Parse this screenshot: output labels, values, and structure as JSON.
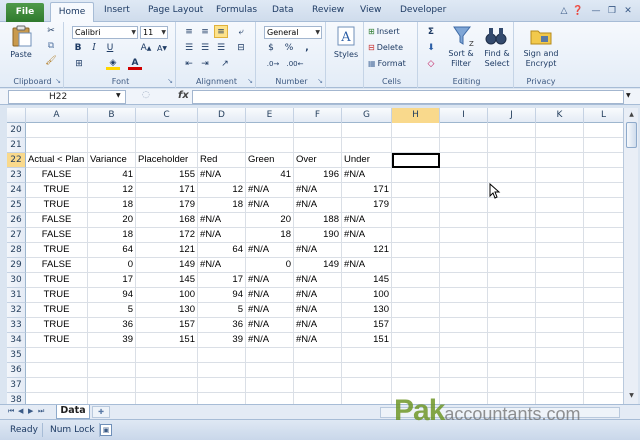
{
  "ribbon": {
    "file_tab": "File",
    "tabs": [
      "Home",
      "Insert",
      "Page Layout",
      "Formulas",
      "Data",
      "Review",
      "View",
      "Developer"
    ],
    "groups": {
      "clipboard": {
        "label": "Clipboard",
        "paste": "Paste"
      },
      "font": {
        "label": "Font",
        "font_name": "Calibri",
        "font_size": "11"
      },
      "alignment": {
        "label": "Alignment"
      },
      "number": {
        "label": "Number",
        "format": "General"
      },
      "styles": {
        "label": "Styles"
      },
      "cells": {
        "label": "Cells",
        "insert": "Insert",
        "delete": "Delete",
        "format": "Format"
      },
      "editing": {
        "label": "Editing",
        "sort_filter_1": "Sort &",
        "sort_filter_2": "Filter",
        "find_select_1": "Find &",
        "find_select_2": "Select"
      },
      "privacy": {
        "label": "Privacy",
        "sign_1": "Sign and",
        "sign_2": "Encrypt"
      }
    }
  },
  "formula_bar": {
    "name_box": "H22",
    "fx": "fx",
    "content": ""
  },
  "grid": {
    "columns": [
      "A",
      "B",
      "C",
      "D",
      "E",
      "F",
      "G",
      "H",
      "I",
      "J",
      "K",
      "L"
    ],
    "rows": [
      {
        "num": "20",
        "cells": [
          "",
          "",
          "",
          "",
          "",
          "",
          ""
        ]
      },
      {
        "num": "21",
        "cells": [
          "",
          "",
          "",
          "",
          "",
          "",
          ""
        ]
      },
      {
        "num": "22",
        "cells": [
          "Actual < Plan",
          "Variance",
          "Placeholder",
          "Red",
          "Green",
          "Over",
          "Under"
        ]
      },
      {
        "num": "23",
        "cells": [
          "FALSE",
          "41",
          "155",
          "#N/A",
          "41",
          "196",
          "#N/A"
        ]
      },
      {
        "num": "24",
        "cells": [
          "TRUE",
          "12",
          "171",
          "12",
          "#N/A",
          "#N/A",
          "171"
        ]
      },
      {
        "num": "25",
        "cells": [
          "TRUE",
          "18",
          "179",
          "18",
          "#N/A",
          "#N/A",
          "179"
        ]
      },
      {
        "num": "26",
        "cells": [
          "FALSE",
          "20",
          "168",
          "#N/A",
          "20",
          "188",
          "#N/A"
        ]
      },
      {
        "num": "27",
        "cells": [
          "FALSE",
          "18",
          "172",
          "#N/A",
          "18",
          "190",
          "#N/A"
        ]
      },
      {
        "num": "28",
        "cells": [
          "TRUE",
          "64",
          "121",
          "64",
          "#N/A",
          "#N/A",
          "121"
        ]
      },
      {
        "num": "29",
        "cells": [
          "FALSE",
          "0",
          "149",
          "#N/A",
          "0",
          "149",
          "#N/A"
        ]
      },
      {
        "num": "30",
        "cells": [
          "TRUE",
          "17",
          "145",
          "17",
          "#N/A",
          "#N/A",
          "145"
        ]
      },
      {
        "num": "31",
        "cells": [
          "TRUE",
          "94",
          "100",
          "94",
          "#N/A",
          "#N/A",
          "100"
        ]
      },
      {
        "num": "32",
        "cells": [
          "TRUE",
          "5",
          "130",
          "5",
          "#N/A",
          "#N/A",
          "130"
        ]
      },
      {
        "num": "33",
        "cells": [
          "TRUE",
          "36",
          "157",
          "36",
          "#N/A",
          "#N/A",
          "157"
        ]
      },
      {
        "num": "34",
        "cells": [
          "TRUE",
          "39",
          "151",
          "39",
          "#N/A",
          "#N/A",
          "151"
        ]
      },
      {
        "num": "35",
        "cells": [
          "",
          "",
          "",
          "",
          "",
          "",
          ""
        ]
      },
      {
        "num": "36",
        "cells": [
          "",
          "",
          "",
          "",
          "",
          "",
          ""
        ]
      },
      {
        "num": "37",
        "cells": [
          "",
          "",
          "",
          "",
          "",
          "",
          ""
        ]
      },
      {
        "num": "38",
        "cells": [
          "",
          "",
          "",
          "",
          "",
          "",
          ""
        ]
      }
    ]
  },
  "sheet_tabs": {
    "active": "Data"
  },
  "status_bar": {
    "ready": "Ready",
    "num_lock": "Num Lock"
  },
  "watermark": {
    "brand": "Pak",
    "rest": "accountants.com"
  },
  "colors": {
    "file_tab": "#3a8a37",
    "header_bg": "#e4ebf5",
    "gridline": "#dadfe6"
  }
}
